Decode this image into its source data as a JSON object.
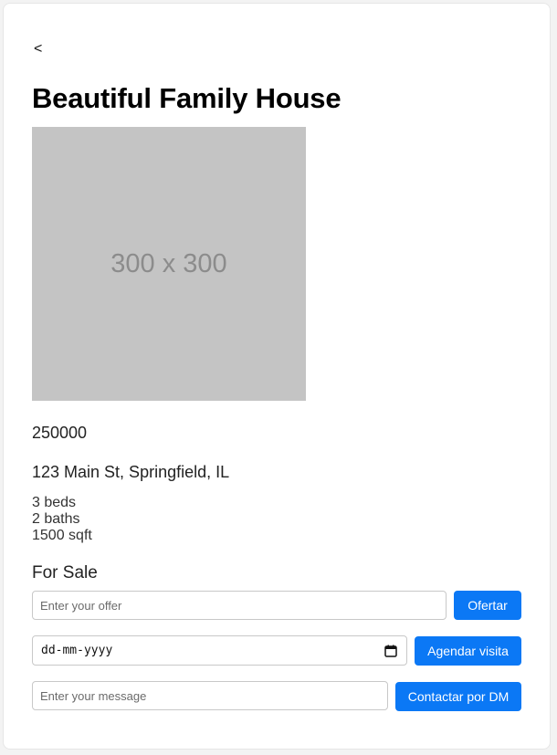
{
  "nav": {
    "back_label": "<"
  },
  "listing": {
    "title": "Beautiful Family House",
    "image_placeholder": "300 x 300",
    "price": "250000",
    "address": "123 Main St, Springfield, IL",
    "beds": "3 beds",
    "baths": "2 baths",
    "area": "1500 sqft",
    "status": "For Sale"
  },
  "offer": {
    "placeholder": "Enter your offer",
    "value": "",
    "button_label": "Ofertar"
  },
  "visit": {
    "date_placeholder": "dd-mm-yyyy",
    "button_label": "Agendar visita"
  },
  "message": {
    "placeholder": "Enter your message",
    "value": "",
    "button_label": "Contactar por DM"
  },
  "colors": {
    "accent": "#0b78f5",
    "image_bg": "#c4c4c4",
    "card_bg": "#ffffff"
  }
}
